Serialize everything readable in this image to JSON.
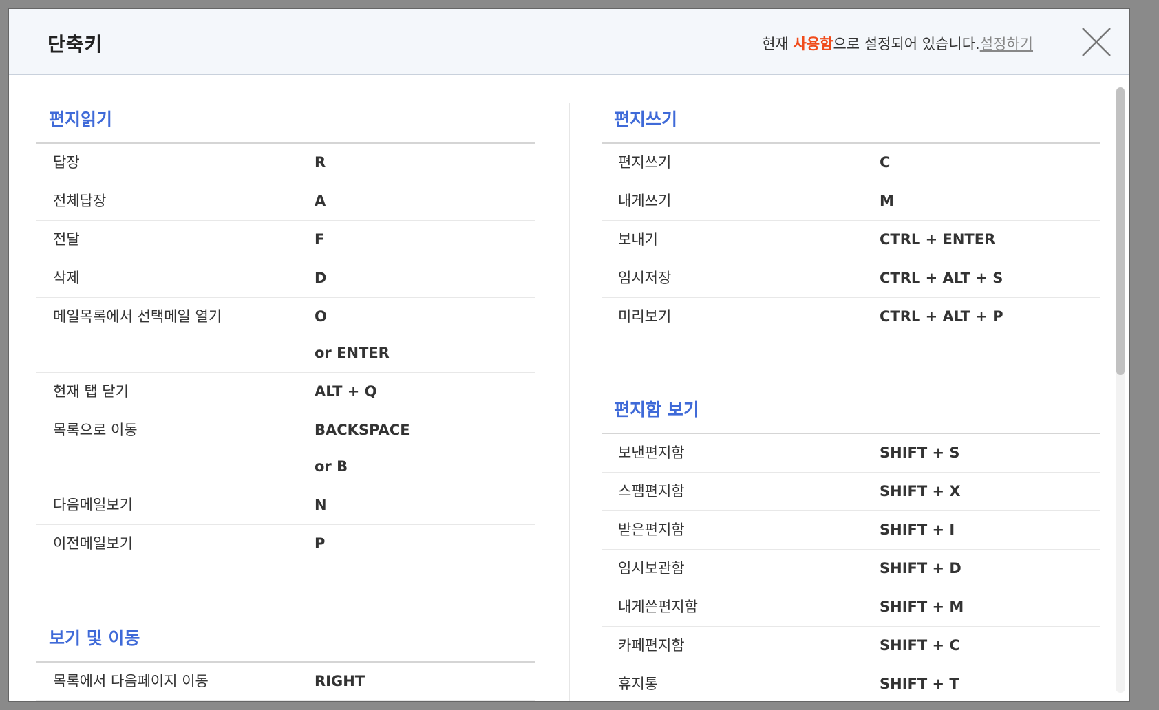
{
  "dialog": {
    "title": "단축키",
    "status_prefix": "현재 ",
    "status_value": "사용함",
    "status_suffix": "으로 설정되어 있습니다.",
    "settings_link": "설정하기"
  },
  "colors": {
    "accent": "#f04b1b",
    "section_title": "#3f6ad8"
  },
  "sections": {
    "read": {
      "title": "편지읽기",
      "rows": [
        {
          "name": "답장",
          "keys": [
            "R"
          ]
        },
        {
          "name": "전체답장",
          "keys": [
            "A"
          ]
        },
        {
          "name": "전달",
          "keys": [
            "F"
          ]
        },
        {
          "name": "삭제",
          "keys": [
            "D"
          ]
        },
        {
          "name": "메일목록에서 선택메일 열기",
          "keys": [
            "O",
            "or ENTER"
          ]
        },
        {
          "name": "현재 탭 닫기",
          "keys": [
            "ALT + Q"
          ]
        },
        {
          "name": "목록으로 이동",
          "keys": [
            "BACKSPACE",
            "or B"
          ]
        },
        {
          "name": "다음메일보기",
          "keys": [
            "N"
          ]
        },
        {
          "name": "이전메일보기",
          "keys": [
            "P"
          ]
        }
      ]
    },
    "view": {
      "title": "보기 및 이동",
      "rows": [
        {
          "name": "목록에서 다음페이지 이동",
          "keys": [
            "RIGHT"
          ]
        }
      ]
    },
    "write": {
      "title": "편지쓰기",
      "rows": [
        {
          "name": "편지쓰기",
          "keys": [
            "C"
          ]
        },
        {
          "name": "내게쓰기",
          "keys": [
            "M"
          ]
        },
        {
          "name": "보내기",
          "keys": [
            "CTRL + ENTER"
          ]
        },
        {
          "name": "임시저장",
          "keys": [
            "CTRL + ALT + S"
          ]
        },
        {
          "name": "미리보기",
          "keys": [
            "CTRL + ALT + P"
          ]
        }
      ]
    },
    "folders": {
      "title": "편지함 보기",
      "rows": [
        {
          "name": "보낸편지함",
          "keys": [
            "SHIFT + S"
          ]
        },
        {
          "name": "스팸편지함",
          "keys": [
            "SHIFT + X"
          ]
        },
        {
          "name": "받은편지함",
          "keys": [
            "SHIFT + I"
          ]
        },
        {
          "name": "임시보관함",
          "keys": [
            "SHIFT + D"
          ]
        },
        {
          "name": "내게쓴편지함",
          "keys": [
            "SHIFT + M"
          ]
        },
        {
          "name": "카페편지함",
          "keys": [
            "SHIFT + C"
          ]
        },
        {
          "name": "휴지통",
          "keys": [
            "SHIFT + T"
          ]
        }
      ]
    }
  },
  "icons": {
    "close": "close-icon"
  }
}
